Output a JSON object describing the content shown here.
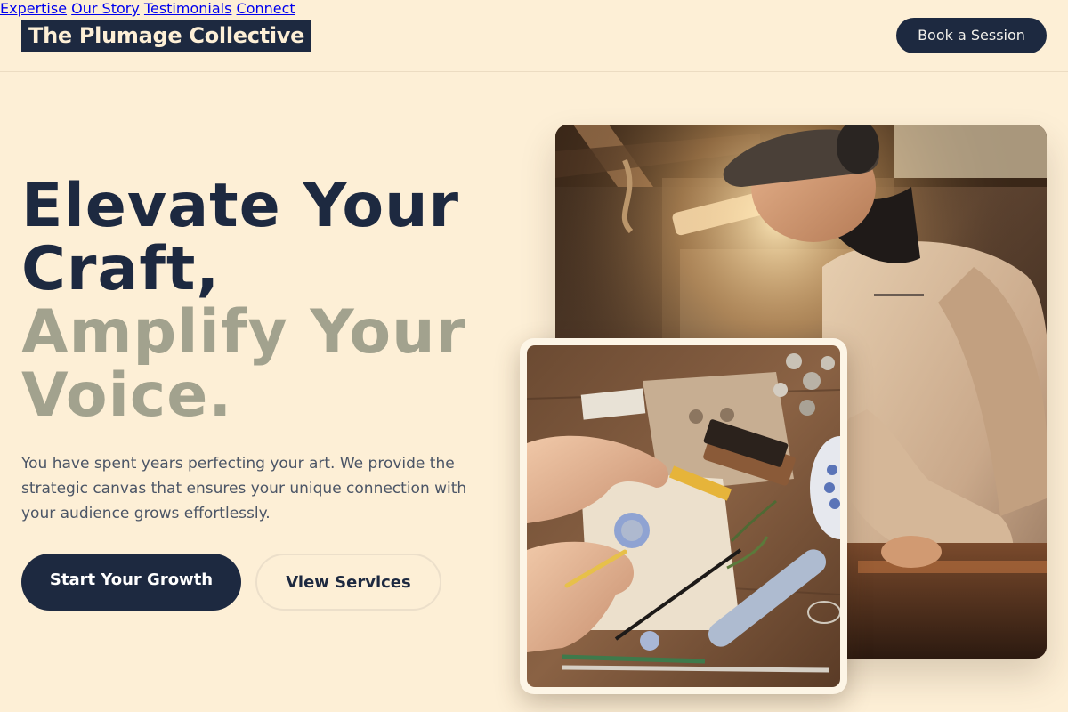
{
  "brand": {
    "name": "The Plumage Collective"
  },
  "nav": {
    "items": [
      {
        "label": "Expertise"
      },
      {
        "label": "Our Story"
      },
      {
        "label": "Testimonials"
      },
      {
        "label": "Connect"
      }
    ],
    "cta_label": "Book a Session"
  },
  "hero": {
    "headline_line1": "Elevate Your",
    "headline_line2": "Craft,",
    "headline_line3": "Amplify Your",
    "headline_line4": "Voice.",
    "subtext": "You have spent years perfecting your art. We provide the strategic canvas that ensures your unique connection with your audience grows effortlessly.",
    "primary_button": "Start Your Growth",
    "secondary_button": "View Services"
  },
  "images": {
    "main_photo": "craftsman-working-photo",
    "inset_photo": "wax-seal-workbench-photo"
  },
  "colors": {
    "background": "#fdefd6",
    "navy": "#1d2940",
    "muted_sage": "#a2a28e",
    "body_text": "#4b5566"
  }
}
